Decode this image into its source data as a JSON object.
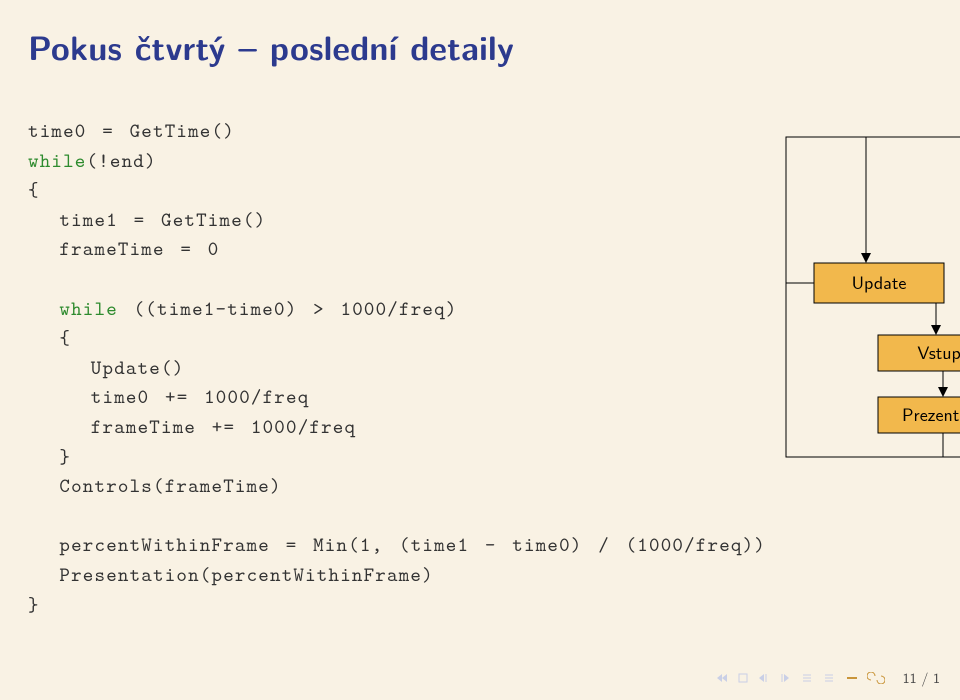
{
  "title": "Pokus čtvrtý – poslední detaily",
  "code": {
    "l1a": "time0 = GetTime()",
    "kw_while1": "while",
    "l2b": "(!end)",
    "l3": "{",
    "l4": "  time1 = GetTime()",
    "l5": "  frameTime = 0",
    "blank1": "",
    "kw_while2": "  while",
    "l7b": " ((time1-time0) > 1000/freq)",
    "l8": "  {",
    "l9": "    Update()",
    "l10": "    time0 += 1000/freq",
    "l11": "    frameTime += 1000/freq",
    "l12": "  }",
    "l13": "  Controls(frameTime)",
    "blank2": "",
    "l15": "  percentWithinFrame = Min(1, (time1 - time0) / (1000/freq))",
    "l16": "  Presentation(percentWithinFrame)",
    "l17": "}"
  },
  "diagram": {
    "update": "Update",
    "vstupy": "Vstupy",
    "prezentace": "Prezentace"
  },
  "page": "11 / 1"
}
